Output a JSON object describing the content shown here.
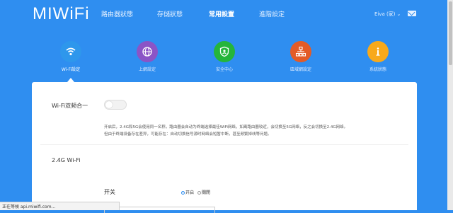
{
  "app": {
    "logo": "MIWiFi"
  },
  "nav": [
    {
      "label": "路由器狀態"
    },
    {
      "label": "存儲狀態"
    },
    {
      "label": "常用設置"
    },
    {
      "label": "進階設定"
    }
  ],
  "user": {
    "name": "Eiva (家)"
  },
  "features": [
    {
      "label": "Wi-Fi設定",
      "icon": "wifi-icon",
      "color": "#2e97ec"
    },
    {
      "label": "上網設定",
      "icon": "globe-icon",
      "color": "#8b54c6"
    },
    {
      "label": "安全中心",
      "icon": "shield-icon",
      "color": "#25b53a"
    },
    {
      "label": "區域網設定",
      "icon": "lan-icon",
      "color": "#e35b27"
    },
    {
      "label": "系統狀態",
      "icon": "info-icon",
      "color": "#f8a91b"
    }
  ],
  "dual_band": {
    "title": "Wi-Fi双频合一",
    "enabled": false,
    "desc_line1": "开启后，2.4G和5G会使用同一名称，路由器会自动为终端选择最佳WiFi网络，如离路由器较近，会切换至5G网络，反之会切换至2.4G网络。",
    "desc_line2": "但由于终端设备存在差异，可能存在：自动切换信号源时网络会短暂中断，甚至频繁掉线等问题。"
  },
  "wifi24": {
    "title": "2.4G Wi-Fi",
    "switch_label": "开关",
    "on_label": "开启",
    "off_label": "關閉",
    "selected": "on"
  },
  "status_bar": {
    "text": "正在等候 api.miwifi.com..."
  }
}
